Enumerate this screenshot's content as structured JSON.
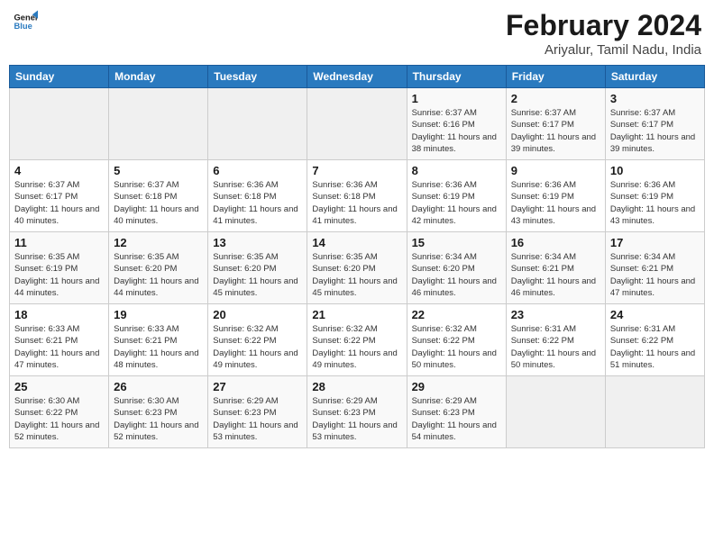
{
  "header": {
    "logo_line1": "General",
    "logo_line2": "Blue",
    "month_year": "February 2024",
    "location": "Ariyalur, Tamil Nadu, India"
  },
  "weekdays": [
    "Sunday",
    "Monday",
    "Tuesday",
    "Wednesday",
    "Thursday",
    "Friday",
    "Saturday"
  ],
  "weeks": [
    [
      {
        "day": "",
        "info": ""
      },
      {
        "day": "",
        "info": ""
      },
      {
        "day": "",
        "info": ""
      },
      {
        "day": "",
        "info": ""
      },
      {
        "day": "1",
        "info": "Sunrise: 6:37 AM\nSunset: 6:16 PM\nDaylight: 11 hours and 38 minutes."
      },
      {
        "day": "2",
        "info": "Sunrise: 6:37 AM\nSunset: 6:17 PM\nDaylight: 11 hours and 39 minutes."
      },
      {
        "day": "3",
        "info": "Sunrise: 6:37 AM\nSunset: 6:17 PM\nDaylight: 11 hours and 39 minutes."
      }
    ],
    [
      {
        "day": "4",
        "info": "Sunrise: 6:37 AM\nSunset: 6:17 PM\nDaylight: 11 hours and 40 minutes."
      },
      {
        "day": "5",
        "info": "Sunrise: 6:37 AM\nSunset: 6:18 PM\nDaylight: 11 hours and 40 minutes."
      },
      {
        "day": "6",
        "info": "Sunrise: 6:36 AM\nSunset: 6:18 PM\nDaylight: 11 hours and 41 minutes."
      },
      {
        "day": "7",
        "info": "Sunrise: 6:36 AM\nSunset: 6:18 PM\nDaylight: 11 hours and 41 minutes."
      },
      {
        "day": "8",
        "info": "Sunrise: 6:36 AM\nSunset: 6:19 PM\nDaylight: 11 hours and 42 minutes."
      },
      {
        "day": "9",
        "info": "Sunrise: 6:36 AM\nSunset: 6:19 PM\nDaylight: 11 hours and 43 minutes."
      },
      {
        "day": "10",
        "info": "Sunrise: 6:36 AM\nSunset: 6:19 PM\nDaylight: 11 hours and 43 minutes."
      }
    ],
    [
      {
        "day": "11",
        "info": "Sunrise: 6:35 AM\nSunset: 6:19 PM\nDaylight: 11 hours and 44 minutes."
      },
      {
        "day": "12",
        "info": "Sunrise: 6:35 AM\nSunset: 6:20 PM\nDaylight: 11 hours and 44 minutes."
      },
      {
        "day": "13",
        "info": "Sunrise: 6:35 AM\nSunset: 6:20 PM\nDaylight: 11 hours and 45 minutes."
      },
      {
        "day": "14",
        "info": "Sunrise: 6:35 AM\nSunset: 6:20 PM\nDaylight: 11 hours and 45 minutes."
      },
      {
        "day": "15",
        "info": "Sunrise: 6:34 AM\nSunset: 6:20 PM\nDaylight: 11 hours and 46 minutes."
      },
      {
        "day": "16",
        "info": "Sunrise: 6:34 AM\nSunset: 6:21 PM\nDaylight: 11 hours and 46 minutes."
      },
      {
        "day": "17",
        "info": "Sunrise: 6:34 AM\nSunset: 6:21 PM\nDaylight: 11 hours and 47 minutes."
      }
    ],
    [
      {
        "day": "18",
        "info": "Sunrise: 6:33 AM\nSunset: 6:21 PM\nDaylight: 11 hours and 47 minutes."
      },
      {
        "day": "19",
        "info": "Sunrise: 6:33 AM\nSunset: 6:21 PM\nDaylight: 11 hours and 48 minutes."
      },
      {
        "day": "20",
        "info": "Sunrise: 6:32 AM\nSunset: 6:22 PM\nDaylight: 11 hours and 49 minutes."
      },
      {
        "day": "21",
        "info": "Sunrise: 6:32 AM\nSunset: 6:22 PM\nDaylight: 11 hours and 49 minutes."
      },
      {
        "day": "22",
        "info": "Sunrise: 6:32 AM\nSunset: 6:22 PM\nDaylight: 11 hours and 50 minutes."
      },
      {
        "day": "23",
        "info": "Sunrise: 6:31 AM\nSunset: 6:22 PM\nDaylight: 11 hours and 50 minutes."
      },
      {
        "day": "24",
        "info": "Sunrise: 6:31 AM\nSunset: 6:22 PM\nDaylight: 11 hours and 51 minutes."
      }
    ],
    [
      {
        "day": "25",
        "info": "Sunrise: 6:30 AM\nSunset: 6:22 PM\nDaylight: 11 hours and 52 minutes."
      },
      {
        "day": "26",
        "info": "Sunrise: 6:30 AM\nSunset: 6:23 PM\nDaylight: 11 hours and 52 minutes."
      },
      {
        "day": "27",
        "info": "Sunrise: 6:29 AM\nSunset: 6:23 PM\nDaylight: 11 hours and 53 minutes."
      },
      {
        "day": "28",
        "info": "Sunrise: 6:29 AM\nSunset: 6:23 PM\nDaylight: 11 hours and 53 minutes."
      },
      {
        "day": "29",
        "info": "Sunrise: 6:29 AM\nSunset: 6:23 PM\nDaylight: 11 hours and 54 minutes."
      },
      {
        "day": "",
        "info": ""
      },
      {
        "day": "",
        "info": ""
      }
    ]
  ]
}
